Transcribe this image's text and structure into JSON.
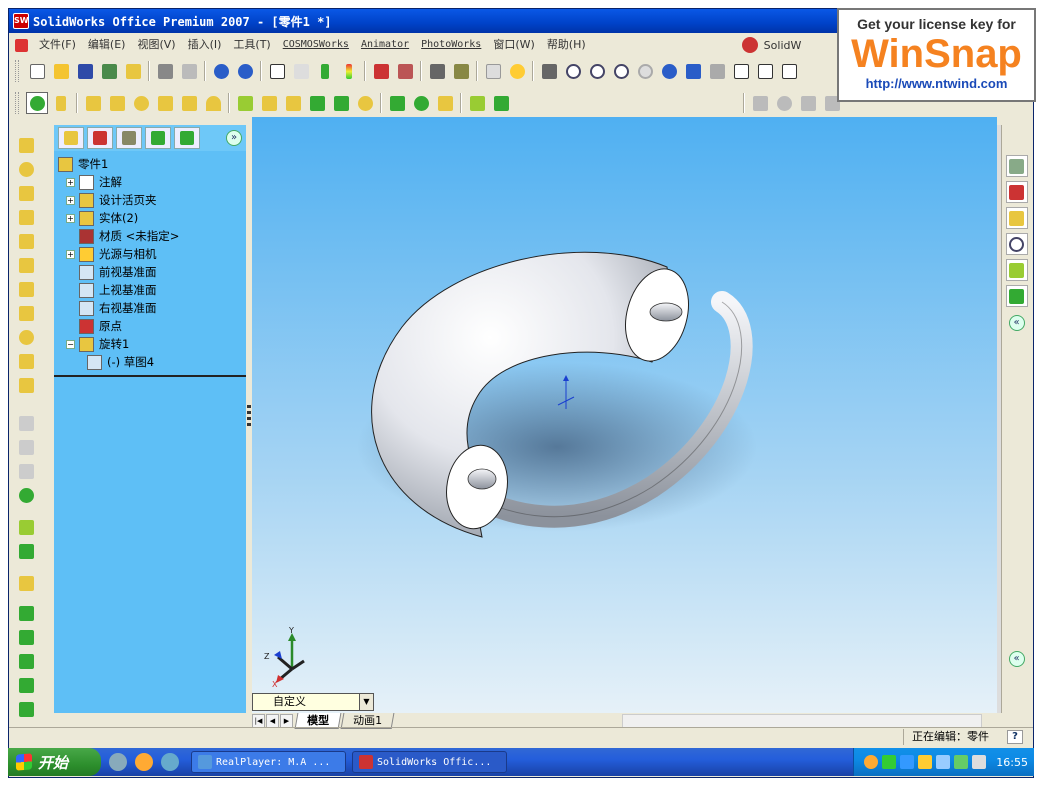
{
  "window": {
    "title": "SolidWorks Office Premium 2007 - [零件1 *]",
    "app_icon_text": "SW"
  },
  "menu": {
    "items": [
      "文件(F)",
      "编辑(E)",
      "视图(V)",
      "插入(I)",
      "工具(T)",
      "COSMOSWorks",
      "Animator",
      "PhotoWorks",
      "窗口(W)",
      "帮助(H)"
    ],
    "solidworks_dropdown": "SolidW"
  },
  "feature_manager": {
    "tree": [
      {
        "label": "零件1",
        "icon": "part-icon",
        "indent": 0,
        "expander": ""
      },
      {
        "label": "注解",
        "icon": "annotations-icon",
        "indent": 1,
        "expander": "+"
      },
      {
        "label": "设计活页夹",
        "icon": "design-binder-icon",
        "indent": 1,
        "expander": "+"
      },
      {
        "label": "实体(2)",
        "icon": "solid-bodies-icon",
        "indent": 1,
        "expander": "+"
      },
      {
        "label": "材质 <未指定>",
        "icon": "material-icon",
        "indent": 1,
        "expander": ""
      },
      {
        "label": "光源与相机",
        "icon": "lights-camera-icon",
        "indent": 1,
        "expander": "+"
      },
      {
        "label": "前视基准面",
        "icon": "plane-icon",
        "indent": 1,
        "expander": ""
      },
      {
        "label": "上视基准面",
        "icon": "plane-icon",
        "indent": 1,
        "expander": ""
      },
      {
        "label": "右视基准面",
        "icon": "plane-icon",
        "indent": 1,
        "expander": ""
      },
      {
        "label": "原点",
        "icon": "origin-icon",
        "indent": 1,
        "expander": ""
      },
      {
        "label": "旋转1",
        "icon": "revolve-icon",
        "indent": 1,
        "expander": "−"
      },
      {
        "label": "(-) 草图4",
        "icon": "sketch-icon",
        "indent": 2,
        "expander": ""
      }
    ],
    "collapse_button": "»"
  },
  "view": {
    "triad": {
      "x_label": "X",
      "y_label": "Y",
      "z_label": "Z"
    },
    "view_combo": "自定义",
    "sheet_tabs": [
      "模型",
      "动画1"
    ]
  },
  "status": {
    "editing": "正在编辑：零件",
    "help_label": "?"
  },
  "taskbar": {
    "start_label": "开始",
    "tasks": [
      "RealPlayer: M.A ...",
      "SolidWorks Offic..."
    ],
    "clock": "16:55"
  },
  "watermark": {
    "line1": "Get your license key for",
    "line2": "WinSnap",
    "line3": "http://www.ntwind.com"
  },
  "colors": {
    "feature_manager_bg": "#5ebff6",
    "viewport_top": "#4fb0f2",
    "viewport_bottom": "#e6f1f8",
    "titlebar": "#0a58e6",
    "accent": "#f58220"
  }
}
